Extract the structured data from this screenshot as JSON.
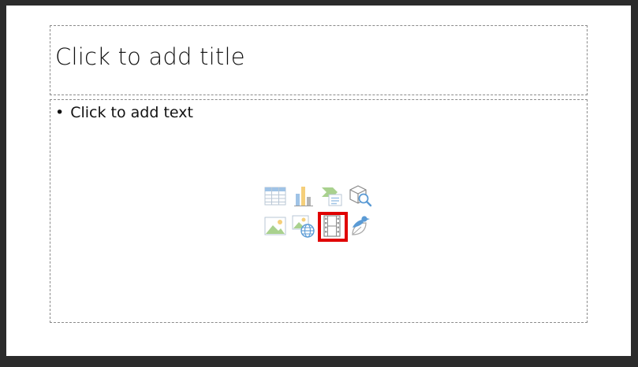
{
  "slide": {
    "title_placeholder": "Click to add title",
    "content_placeholder": {
      "bullet": "•",
      "text": "Click to add text"
    },
    "insert_icons": [
      {
        "name": "insert-table-icon"
      },
      {
        "name": "insert-chart-icon"
      },
      {
        "name": "insert-smartart-icon"
      },
      {
        "name": "insert-3d-model-icon"
      },
      {
        "name": "insert-picture-icon"
      },
      {
        "name": "insert-online-picture-icon"
      },
      {
        "name": "insert-video-icon",
        "highlighted": true
      },
      {
        "name": "insert-icons-icon"
      }
    ],
    "highlight_color": "#e00000"
  }
}
